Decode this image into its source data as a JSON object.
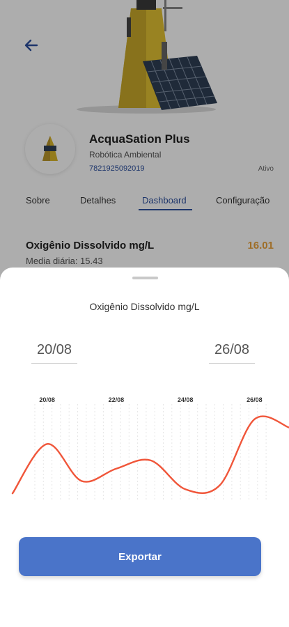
{
  "device": {
    "name": "AcquaSation Plus",
    "organization": "Robótica Ambiental",
    "serial": "7821925092019",
    "status": "Ativo"
  },
  "tabs": [
    {
      "label": "Sobre"
    },
    {
      "label": "Detalhes"
    },
    {
      "label": "Dashboard",
      "active": true
    },
    {
      "label": "Configuração"
    }
  ],
  "metric": {
    "title": "Oxigênio Dissolvido mg/L",
    "value": "16.01",
    "daily_average": "Media diária: 15.43",
    "value_color": "#e9a23b"
  },
  "sheet": {
    "title": "Oxigênio Dissolvido mg/L",
    "date_start": "20/08",
    "date_end": "26/08",
    "export_label": "Exportar"
  },
  "colors": {
    "accent": "#2c4f9e",
    "button": "#4a74c9",
    "line": "#f0563a"
  },
  "icons": {
    "back": "arrow-left-icon"
  },
  "chart_data": {
    "type": "line",
    "x": [
      "19/08",
      "20/08",
      "21/08",
      "22/08",
      "23/08",
      "24/08",
      "25/08",
      "26/08",
      "27/08"
    ],
    "x_tick_labels": [
      "20/08",
      "22/08",
      "24/08",
      "26/08"
    ],
    "series": [
      {
        "values": [
          15.2,
          16.4,
          15.5,
          15.8,
          16.0,
          15.3,
          15.4,
          17.0,
          16.8
        ]
      }
    ],
    "ylim": [
      15.0,
      17.2
    ],
    "grid": true,
    "legend": "none"
  }
}
